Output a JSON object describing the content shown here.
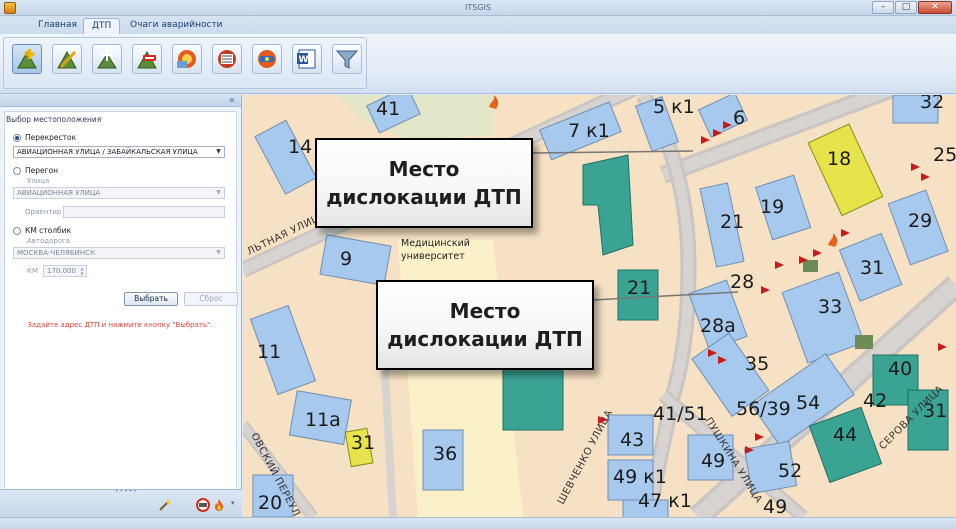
{
  "window": {
    "title": "ITSGIS"
  },
  "tabs": [
    {
      "label": "Главная",
      "active": false
    },
    {
      "label": "ДТП",
      "active": true
    },
    {
      "label": "Очаги аварийности",
      "active": false
    }
  ],
  "toolbar": {
    "tools": [
      {
        "icon": "add-accident-icon",
        "selected": true
      },
      {
        "icon": "edit-accident-icon",
        "selected": false
      },
      {
        "icon": "move-accident-icon",
        "selected": false
      },
      {
        "icon": "delete-accident-icon",
        "selected": false
      },
      {
        "icon": "accident-card-icon",
        "selected": false
      },
      {
        "icon": "accident-list-icon",
        "selected": false
      },
      {
        "icon": "accident-report-icon",
        "selected": false
      },
      {
        "icon": "word-export-icon",
        "selected": false
      },
      {
        "icon": "filter-icon",
        "selected": false
      }
    ]
  },
  "panel": {
    "section_title": "Выбор местоположения",
    "intersection": {
      "label": "Перекресток",
      "checked": true,
      "value": "АВИАЦИОННАЯ УЛИЦА / ЗАБАЙКАЛЬСКАЯ УЛИЦА"
    },
    "segment": {
      "label": "Перегон",
      "checked": false,
      "street_label": "Улица",
      "street_value": "АВИАЦИОННАЯ УЛИЦА",
      "landmark_label": "Ориентир",
      "landmark_value": ""
    },
    "km_post": {
      "label": "КМ столбик",
      "checked": false,
      "road_label": "Автодорога",
      "road_value": "МОСКВА-ЧЕЛЯБИНСК",
      "km_label": "КМ",
      "km_value": "170.000"
    },
    "select_button": "Выбрать",
    "reset_button": "Сброс",
    "hint": "Задайте адрес ДТП и нажмите кнопку \"Выбрать\"."
  },
  "map": {
    "buildings": [
      "41",
      "5 к1",
      "6",
      "32",
      "7 к1",
      "14",
      "18",
      "25",
      "21",
      "19",
      "29",
      "9",
      "31",
      "28",
      "33",
      "21",
      "28а",
      "11",
      "35",
      "40",
      "56/39",
      "54",
      "41/51",
      "42",
      "31",
      "11а",
      "43",
      "44",
      "31",
      "36",
      "49",
      "52",
      "49 к1",
      "47 к1",
      "49",
      "20"
    ],
    "institute_label_line1": "Медицинский",
    "institute_label_line2": "университет",
    "streets": [
      "ШЕВЧЕНКО УЛИЦА",
      "ПУШКИНА УЛИЦА",
      "СЕРОВА УЛИЦА",
      "ЛЬТНАЯ УЛИЦА",
      "ОВСКИЙ ПЕРЕУЛ"
    ],
    "callouts": [
      {
        "line1": "Место",
        "line2": "дислокации ДТП"
      },
      {
        "line1": "Место",
        "line2": "дислокации ДТП"
      }
    ]
  }
}
